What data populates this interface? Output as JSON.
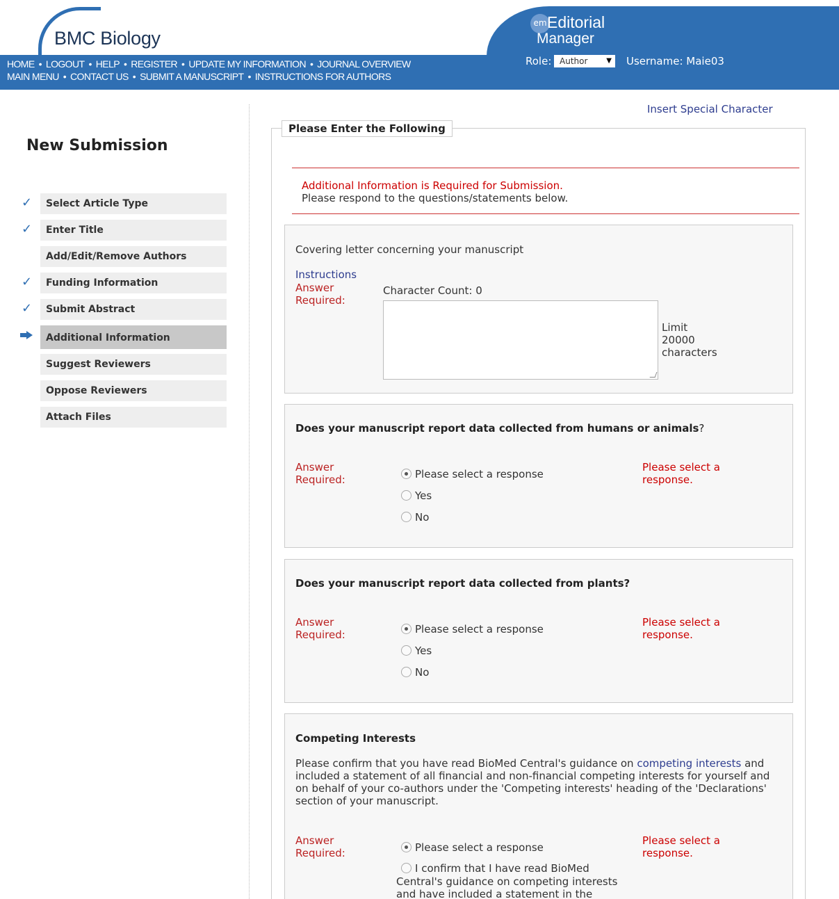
{
  "header": {
    "logo": "BMC Biology",
    "nav_row1": [
      "HOME",
      "LOGOUT",
      "HELP",
      "REGISTER",
      "UPDATE MY INFORMATION",
      "JOURNAL OVERVIEW"
    ],
    "nav_row2": [
      "MAIN MENU",
      "CONTACT US",
      "SUBMIT A MANUSCRIPT",
      "INSTRUCTIONS FOR AUTHORS"
    ],
    "em_badge": "em",
    "em_title_1": "Editorial",
    "em_title_2": "Manager",
    "role_label": "Role:",
    "role_value": "Author",
    "username": "Username: Maie03"
  },
  "sidebar": {
    "title": "New Submission",
    "steps": [
      {
        "label": "Select Article Type",
        "status": "done"
      },
      {
        "label": "Enter Title",
        "status": "done"
      },
      {
        "label": "Add/Edit/Remove Authors",
        "status": "none"
      },
      {
        "label": "Funding Information",
        "status": "done"
      },
      {
        "label": "Submit Abstract",
        "status": "done"
      },
      {
        "label": "Additional Information",
        "status": "current"
      },
      {
        "label": "Suggest Reviewers",
        "status": "none"
      },
      {
        "label": "Oppose Reviewers",
        "status": "none"
      },
      {
        "label": "Attach Files",
        "status": "none"
      }
    ]
  },
  "main": {
    "insert_special_character": "Insert Special Character",
    "legend": "Please Enter the Following",
    "alert_line1": "Additional Information is Required for Submission.",
    "alert_line2": "Please respond to the questions/statements below.",
    "answer_required_1": "Answer",
    "answer_required_2": "Required:",
    "q1": {
      "text": "Covering letter concerning your manuscript",
      "instructions": "Instructions",
      "char_count": "Character Count: 0",
      "limit_1": "Limit",
      "limit_2": "20000",
      "limit_3": "characters"
    },
    "q2": {
      "title": "Does your manuscript report data collected from humans or animals",
      "qmark": "?",
      "options": [
        "Please select a response",
        "Yes",
        "No"
      ],
      "selected": 0,
      "error_1": "Please select a",
      "error_2": "response."
    },
    "q3": {
      "title": "Does your manuscript report data collected from plants?",
      "options": [
        "Please select a response",
        "Yes",
        "No"
      ],
      "selected": 0,
      "error_1": "Please select a",
      "error_2": "response."
    },
    "q4": {
      "title": "Competing Interests",
      "text_before": "Please confirm that you have read BioMed Central's guidance on ",
      "link": "competing interests",
      "text_after": " and included a statement of all financial and non-financial competing interests for yourself and on behalf of your co-authors under the 'Competing interests' heading of the 'Declarations' section of your manuscript.",
      "option1": "Please select a response",
      "option2_line1": "I confirm that I have read BioMed",
      "option2_rest": "Central's guidance on competing interests and have included a statement in the",
      "selected": 0,
      "error_1": "Please select a",
      "error_2": "response."
    }
  }
}
